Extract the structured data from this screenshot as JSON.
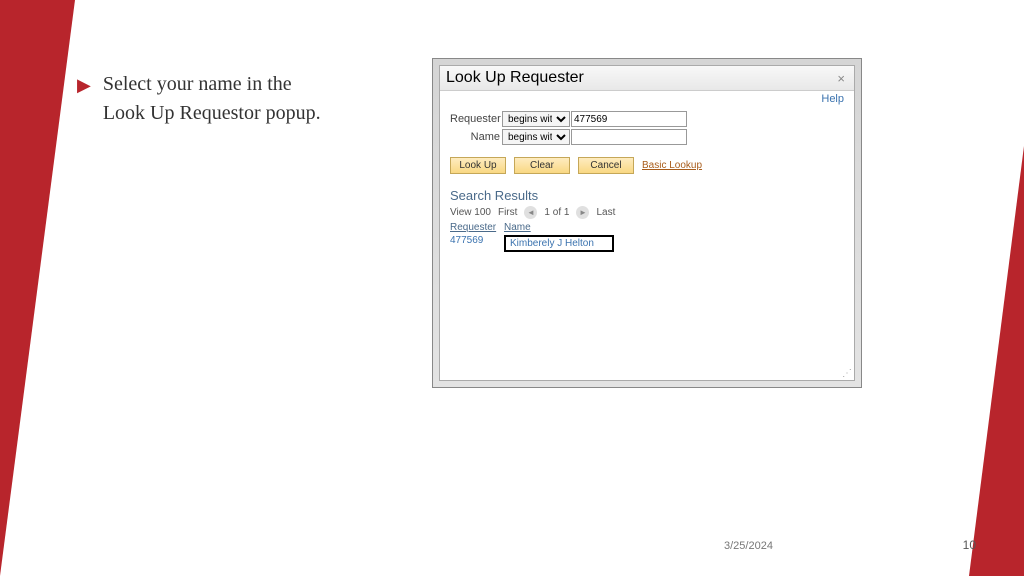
{
  "slide": {
    "bullet_text": "Select your name in the Look Up Requestor popup.",
    "date": "3/25/2024",
    "page_number": "10"
  },
  "dialog": {
    "title": "Look Up Requester",
    "help_label": "Help",
    "close_symbol": "×",
    "form": {
      "requester_label": "Requester",
      "requester_operator": "begins with",
      "requester_value": "477569",
      "name_label": "Name",
      "name_operator": "begins with",
      "name_value": ""
    },
    "buttons": {
      "lookup": "Look Up",
      "clear": "Clear",
      "cancel": "Cancel",
      "basic_lookup": "Basic Lookup"
    },
    "results": {
      "title": "Search Results",
      "view_label": "View 100",
      "first_label": "First",
      "position": "1 of 1",
      "last_label": "Last",
      "header_requester": "Requester",
      "header_name": "Name",
      "rows": [
        {
          "requester": "477569",
          "name": "Kimberely J Helton"
        }
      ]
    }
  }
}
